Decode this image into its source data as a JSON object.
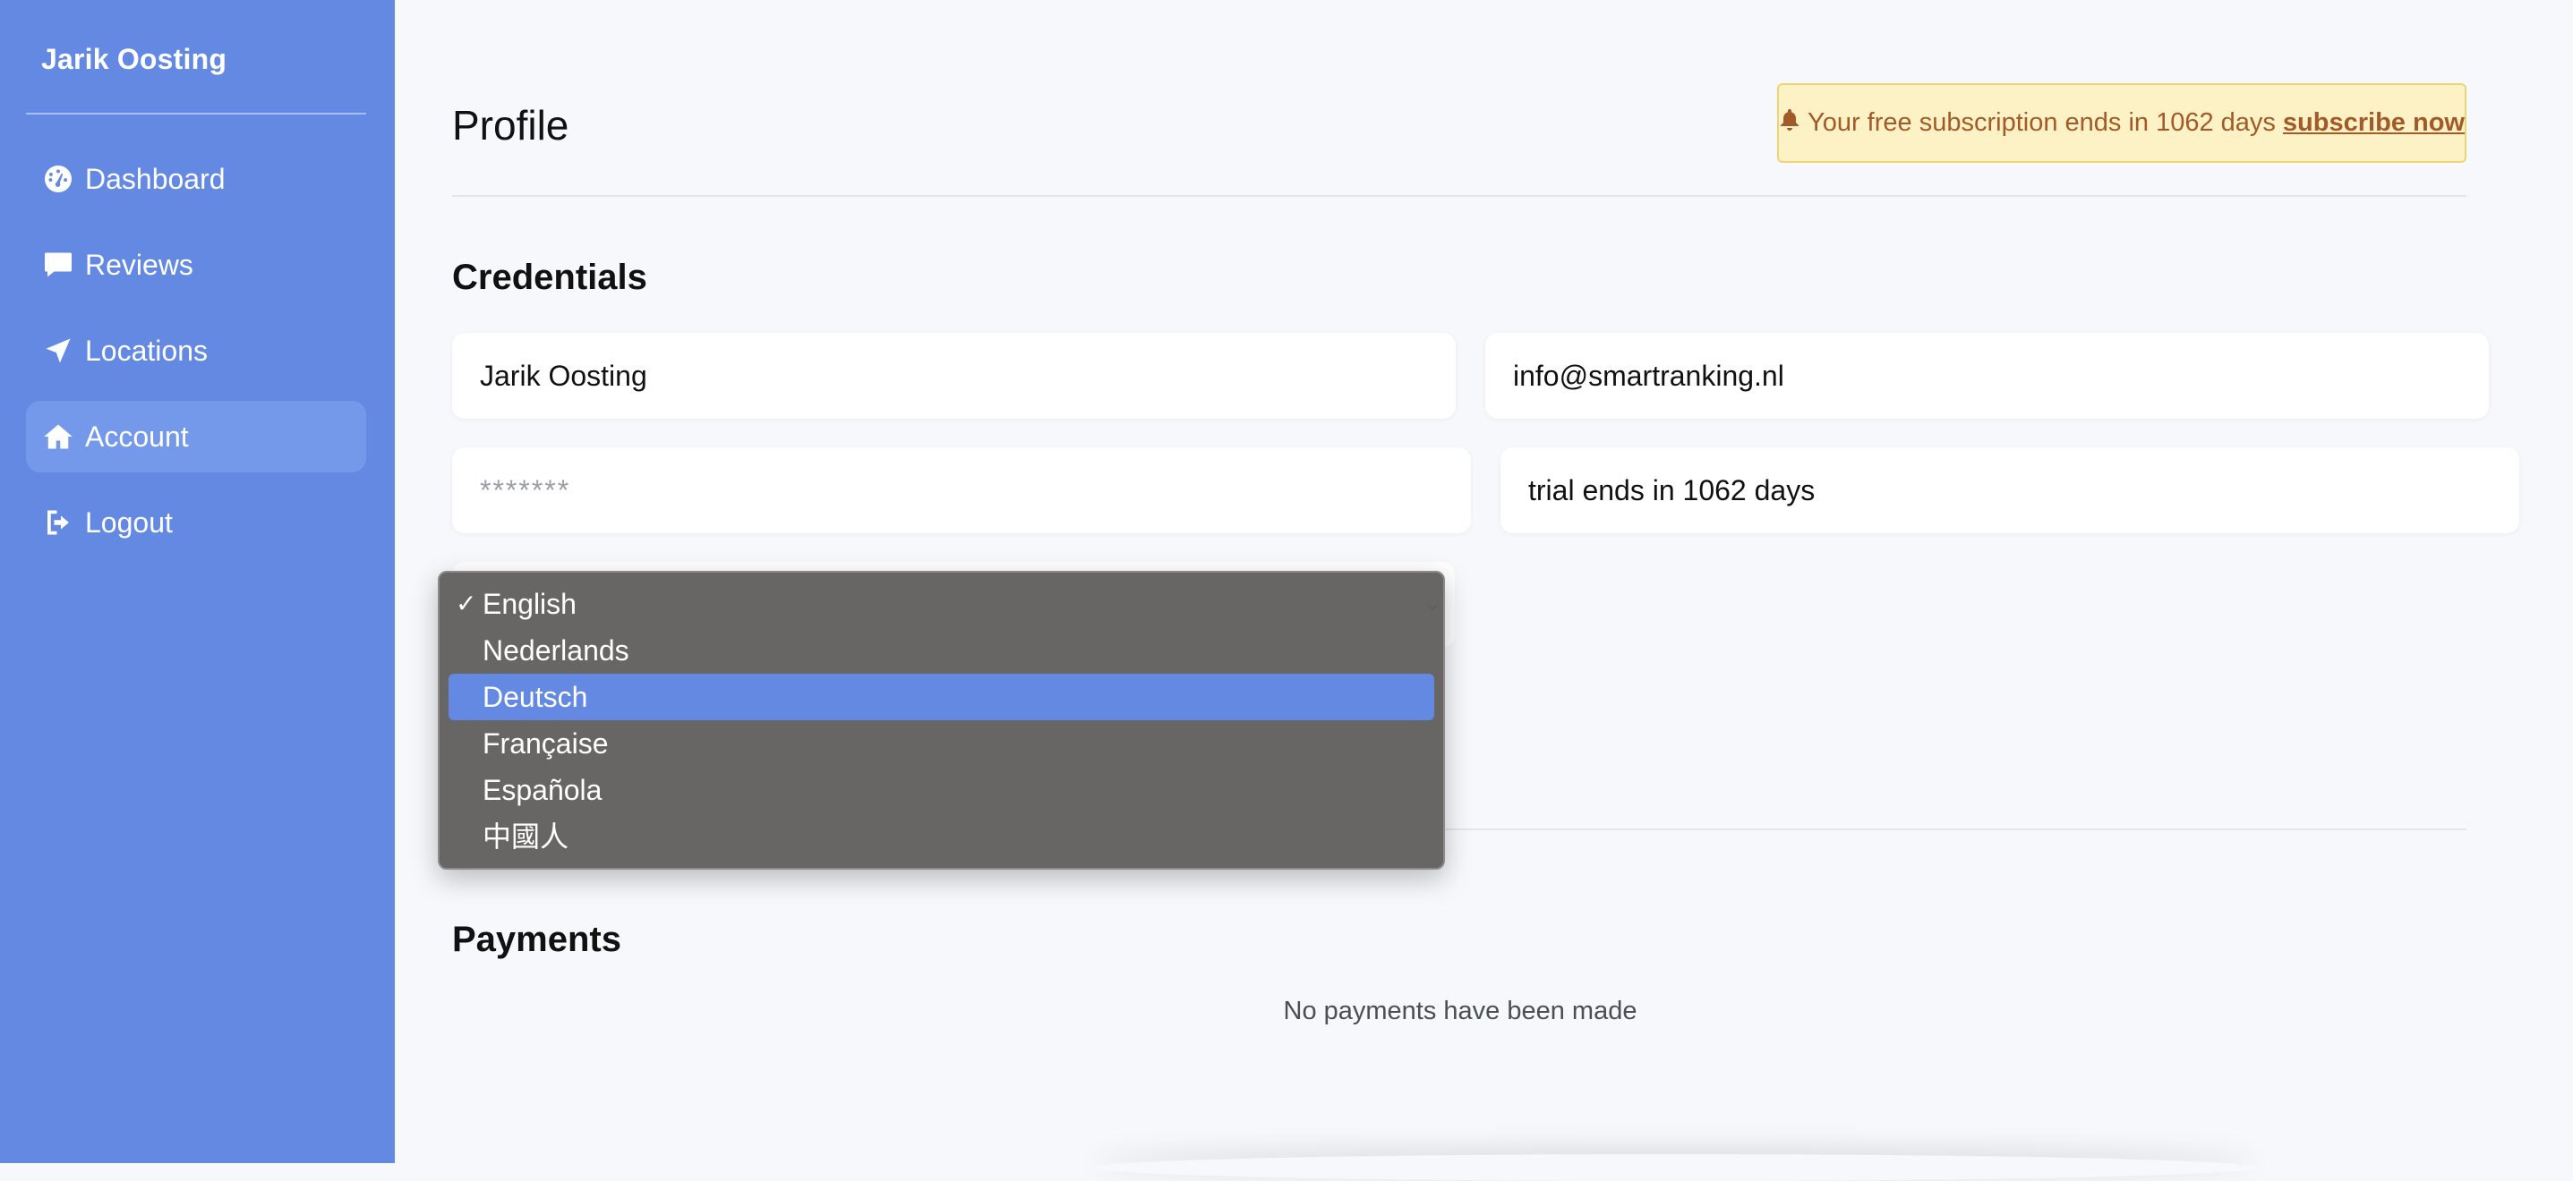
{
  "sidebar": {
    "brand": "Jarik Oosting",
    "items": [
      {
        "label": "Dashboard",
        "icon": "dashboard-icon"
      },
      {
        "label": "Reviews",
        "icon": "comment-icon"
      },
      {
        "label": "Locations",
        "icon": "location-arrow-icon"
      },
      {
        "label": "Account",
        "icon": "home-icon",
        "active": true
      },
      {
        "label": "Logout",
        "icon": "logout-icon"
      }
    ]
  },
  "header": {
    "title": "Profile",
    "alert": {
      "text": "Your free subscription ends in 1062 days",
      "link": "subscribe now",
      "icon": "bell-icon"
    }
  },
  "credentials": {
    "title": "Credentials",
    "name_value": "Jarik Oosting",
    "email_value": "info@smartranking.nl",
    "password_placeholder": "*******",
    "trial_value": "trial ends in 1062 days"
  },
  "language": {
    "options": [
      "English",
      "Nederlands",
      "Deutsch",
      "Française",
      "Española",
      "中國人"
    ],
    "checked": "English",
    "highlighted": "Deutsch"
  },
  "payments": {
    "title": "Payments",
    "empty": "No payments have been made"
  },
  "colors": {
    "sidebar": "#6389e3",
    "alert_bg": "#fdf2c5",
    "alert_text": "#a15a28",
    "dropdown_bg": "#636060",
    "highlight": "#6389e3"
  }
}
